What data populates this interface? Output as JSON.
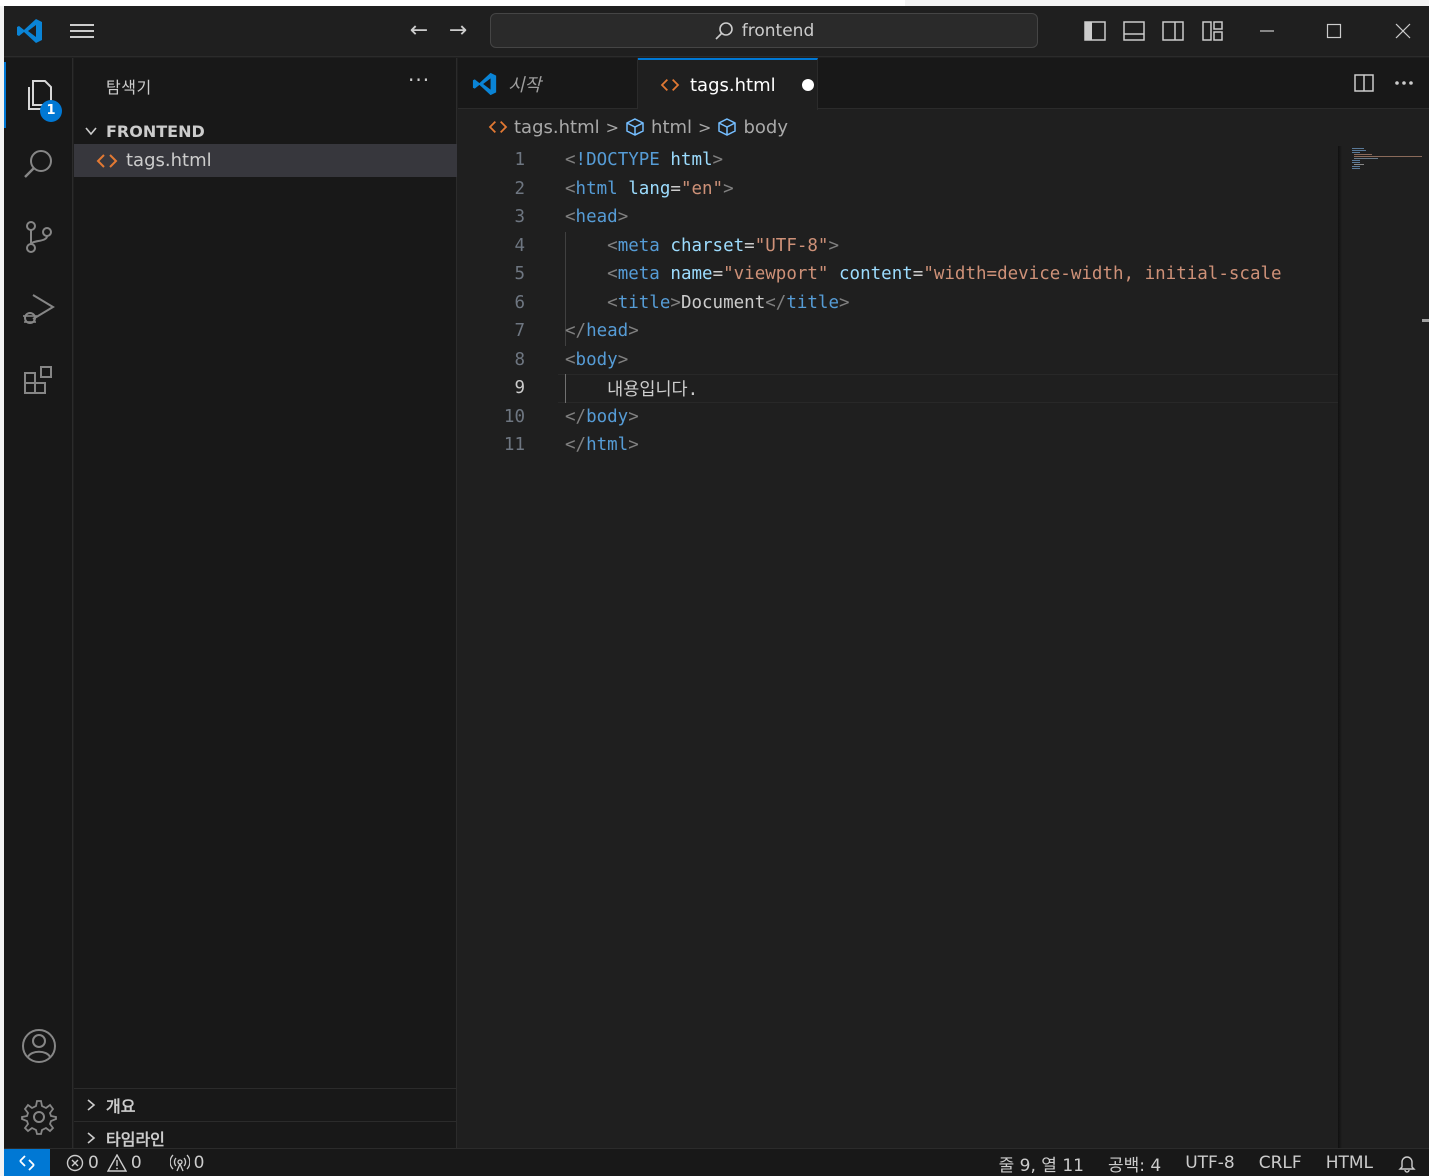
{
  "titlebar": {
    "search_text": "frontend"
  },
  "activity": {
    "explorer_badge": "1"
  },
  "sidebar": {
    "title": "탐색기",
    "more": "···",
    "folder": "FRONTEND",
    "file": "tags.html",
    "sections": [
      "개요",
      "타임라인"
    ]
  },
  "tabs": [
    {
      "label": "시작"
    },
    {
      "label": "tags.html"
    }
  ],
  "breadcrumb": [
    "tags.html",
    "html",
    "body"
  ],
  "editor": {
    "current_line": 9,
    "lines": [
      {
        "n": "1"
      },
      {
        "n": "2"
      },
      {
        "n": "3"
      },
      {
        "n": "4"
      },
      {
        "n": "5"
      },
      {
        "n": "6"
      },
      {
        "n": "7"
      },
      {
        "n": "8"
      },
      {
        "n": "9"
      },
      {
        "n": "10"
      },
      {
        "n": "11"
      }
    ],
    "code": {
      "l1_doctype": "!DOCTYPE",
      "l1_html": "html",
      "l2_tag": "html",
      "l2_attr": "lang",
      "l2_val": "\"en\"",
      "l3_tag": "head",
      "l4_tag": "meta",
      "l4_attr": "charset",
      "l4_val": "\"UTF-8\"",
      "l5_tag": "meta",
      "l5_attr1": "name",
      "l5_val1": "\"viewport\"",
      "l5_attr2": "content",
      "l5_val2": "\"width=device-width, initial-scale",
      "l6_tag": "title",
      "l6_text": "Document",
      "l7_tag": "head",
      "l8_tag": "body",
      "l9_text": "내용입니다.",
      "l10_tag": "body",
      "l11_tag": "html"
    }
  },
  "status": {
    "errors": "0",
    "warnings": "0",
    "ports": "0",
    "position": "줄 9, 열 11",
    "spaces": "공백: 4",
    "encoding": "UTF-8",
    "eol": "CRLF",
    "language": "HTML"
  },
  "colors": {
    "accent": "#0078d4",
    "html_icon": "#e37933"
  }
}
